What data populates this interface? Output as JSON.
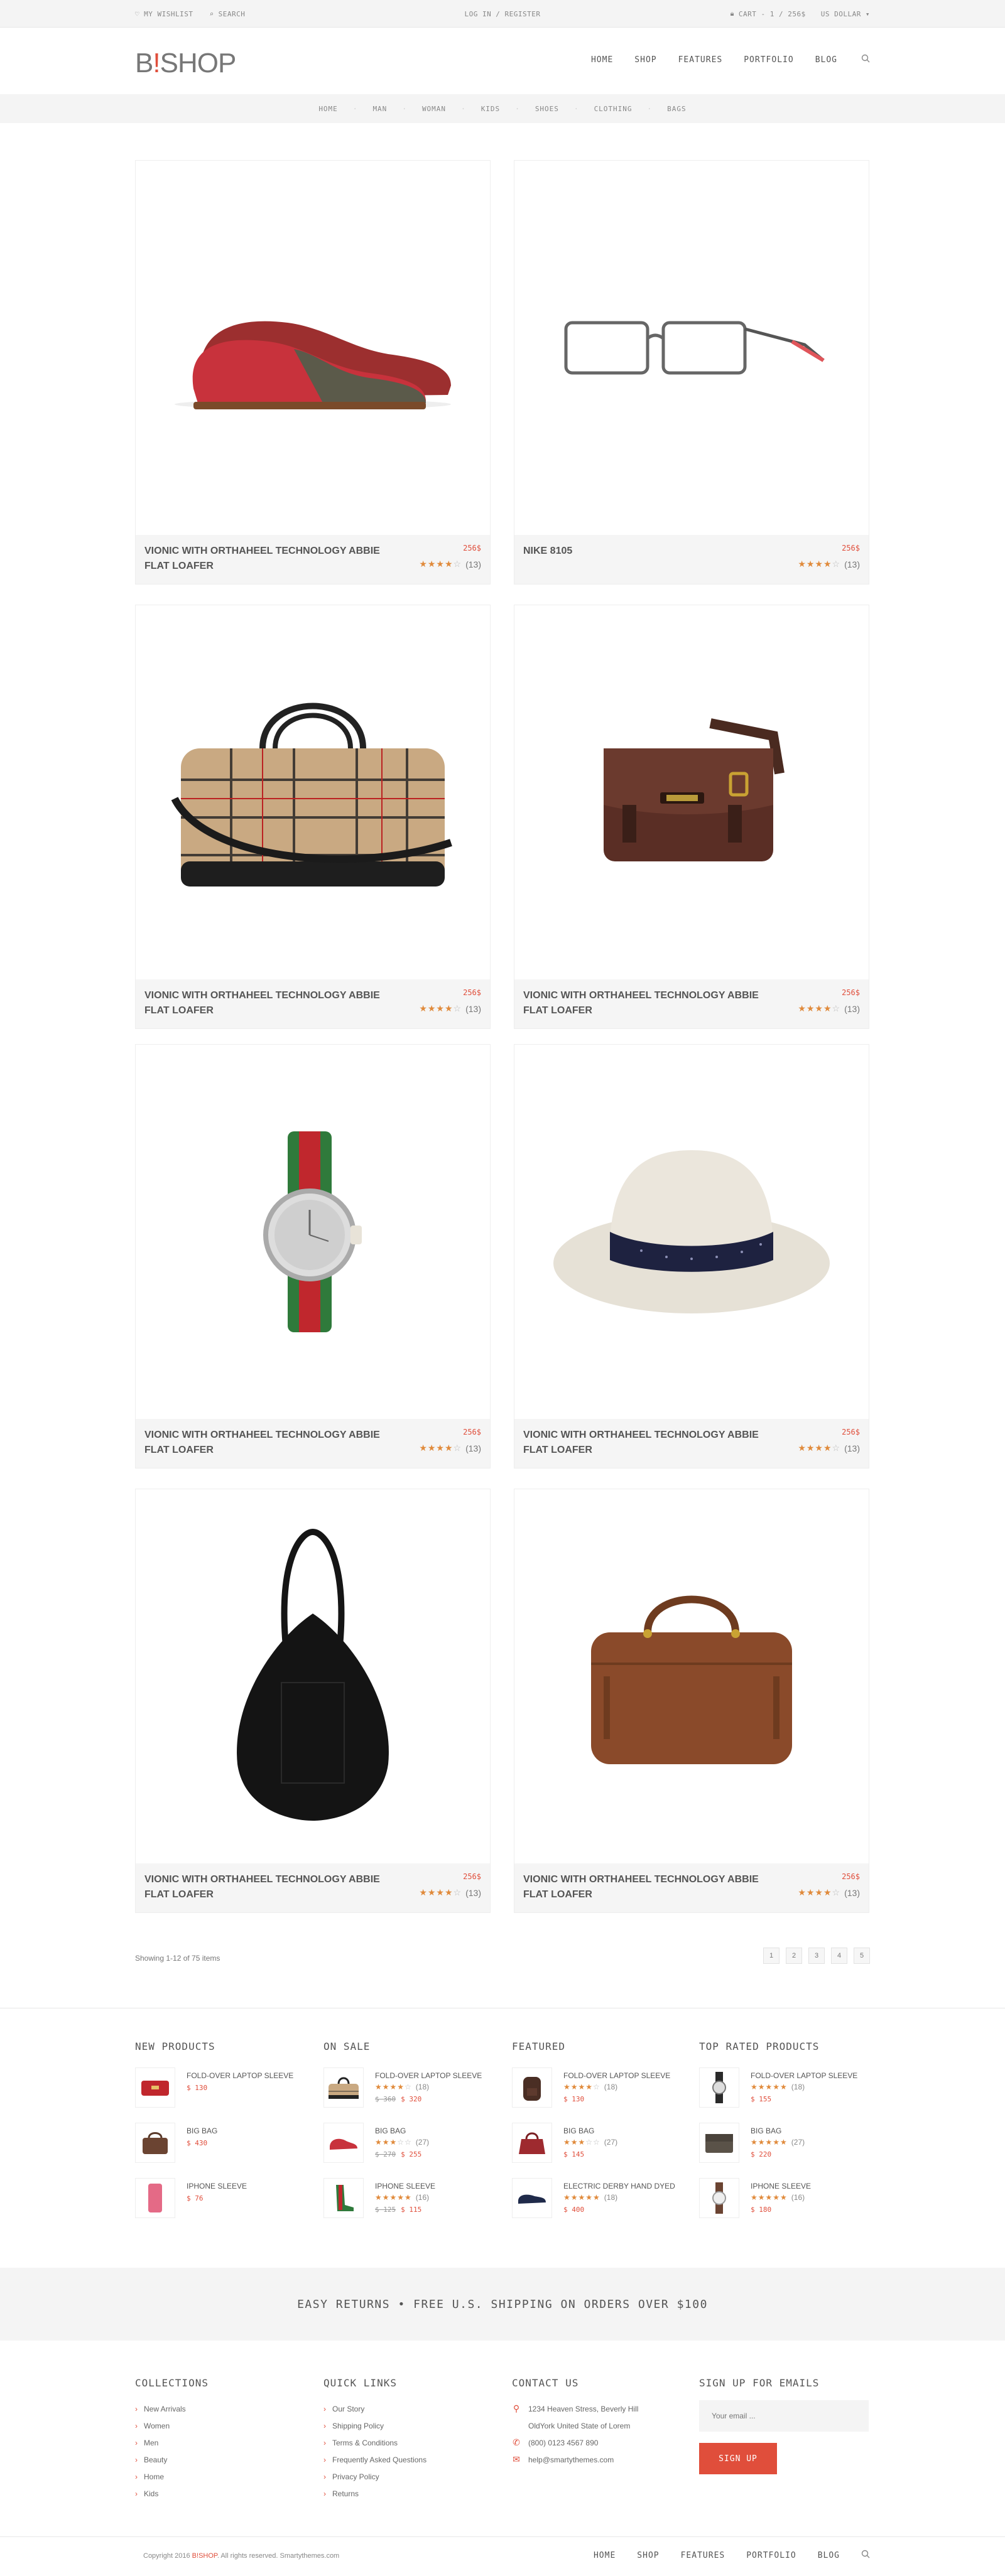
{
  "topbar": {
    "wishlist": "MY WISHLIST",
    "search": "SEARCH",
    "account": "LOG IN / REGISTER",
    "cart": "CART - 1 / 256$",
    "currency": "US DOLLAR"
  },
  "header": {
    "logo_left": "B",
    "logo_mark": "!",
    "logo_right": "SHOP",
    "nav": [
      "HOME",
      "SHOP",
      "FEATURES",
      "PORTFOLIO",
      "BLOG"
    ]
  },
  "categories": [
    "HOME",
    "MAN",
    "WOMAN",
    "KIDS",
    "SHOES",
    "CLOTHING",
    "BAGS"
  ],
  "products": [
    {
      "name": "VIONIC WITH ORTHAHEEL TECHNOLOGY ABBIE FLAT LOAFER",
      "price": "256$",
      "rating": 4,
      "reviews": "(13)",
      "icon": "red-loafers-image"
    },
    {
      "name": "NIKE 8105",
      "price": "256$",
      "rating": 4,
      "reviews": "(13)",
      "icon": "eyeglasses-image"
    },
    {
      "name": "VIONIC WITH ORTHAHEEL TECHNOLOGY ABBIE FLAT LOAFER",
      "price": "256$",
      "rating": 4,
      "reviews": "(13)",
      "icon": "plaid-duffel-bag-image"
    },
    {
      "name": "VIONIC WITH ORTHAHEEL TECHNOLOGY ABBIE FLAT LOAFER",
      "price": "256$",
      "rating": 4,
      "reviews": "(13)",
      "icon": "leather-messenger-bag-image"
    },
    {
      "name": "VIONIC WITH ORTHAHEEL TECHNOLOGY ABBIE FLAT LOAFER",
      "price": "256$",
      "rating": 4,
      "reviews": "(13)",
      "icon": "wristwatch-image"
    },
    {
      "name": "VIONIC WITH ORTHAHEEL TECHNOLOGY ABBIE FLAT LOAFER",
      "price": "256$",
      "rating": 4,
      "reviews": "(13)",
      "icon": "fedora-hat-image"
    },
    {
      "name": "VIONIC WITH ORTHAHEEL TECHNOLOGY ABBIE FLAT LOAFER",
      "price": "256$",
      "rating": 4,
      "reviews": "(13)",
      "icon": "black-hobo-bag-image"
    },
    {
      "name": "VIONIC WITH ORTHAHEEL TECHNOLOGY ABBIE FLAT LOAFER",
      "price": "256$",
      "rating": 4,
      "reviews": "(13)",
      "icon": "brown-duffel-bag-image"
    }
  ],
  "listing": {
    "showing": "Showing 1-12 of 75 items",
    "pages": [
      "1",
      "2",
      "3",
      "4",
      "5"
    ]
  },
  "widgets": [
    {
      "title": "NEW PRODUCTS",
      "items": [
        {
          "name": "FOLD-OVER LAPTOP SLEEVE",
          "price": "$ 130",
          "thumb": "red-clutch"
        },
        {
          "name": "BIG BAG",
          "price": "$ 430",
          "thumb": "brown-satchel"
        },
        {
          "name": "IPHONE SLEEVE",
          "price": "$ 76",
          "thumb": "pink-phone"
        }
      ]
    },
    {
      "title": "ON SALE",
      "items": [
        {
          "name": "FOLD-OVER LAPTOP SLEEVE",
          "rating": 4,
          "reviews": "(18)",
          "old": "$ 360",
          "price": "$ 320",
          "thumb": "plaid-bag"
        },
        {
          "name": "BIG BAG",
          "rating": 3,
          "reviews": "(27)",
          "old": "$ 270",
          "price": "$ 255",
          "thumb": "red-shoe"
        },
        {
          "name": "IPHONE SLEEVE",
          "rating": 5,
          "reviews": "(16)",
          "old": "$ 125",
          "price": "$ 115",
          "thumb": "striped-heel"
        }
      ]
    },
    {
      "title": "FEATURED",
      "items": [
        {
          "name": "FOLD-OVER LAPTOP SLEEVE",
          "rating": 4,
          "reviews": "(18)",
          "price": "$ 130",
          "thumb": "backpack"
        },
        {
          "name": "BIG BAG",
          "rating": 3,
          "reviews": "(27)",
          "price": "$ 145",
          "thumb": "red-handbag"
        },
        {
          "name": "ELECTRIC DERBY HAND DYED",
          "rating": 5,
          "reviews": "(18)",
          "price": "$ 400",
          "thumb": "derby-shoe"
        }
      ]
    },
    {
      "title": "TOP RATED PRODUCTS",
      "items": [
        {
          "name": "FOLD-OVER LAPTOP SLEEVE",
          "rating": 5,
          "reviews": "(18)",
          "price": "$ 155",
          "thumb": "watch"
        },
        {
          "name": "BIG BAG",
          "rating": 5,
          "reviews": "(27)",
          "price": "$ 220",
          "thumb": "grey-bag"
        },
        {
          "name": "IPHONE SLEEVE",
          "rating": 5,
          "reviews": "(16)",
          "price": "$ 180",
          "thumb": "watch-2"
        }
      ]
    }
  ],
  "banner": "EASY RETURNS • FREE U.S. SHIPPING ON ORDERS OVER $100",
  "footer": {
    "collections_title": "COLLECTIONS",
    "collections": [
      "New Arrivals",
      "Women",
      "Men",
      "Beauty",
      "Home",
      "Kids"
    ],
    "quicklinks_title": "QUICK LINKS",
    "quicklinks": [
      "Our Story",
      "Shipping Policy",
      "Terms & Conditions",
      "Frequently Asked Questions",
      "Privacy Policy",
      "Returns"
    ],
    "contact_title": "CONTACT US",
    "contact": [
      {
        "icon": "map-pin-icon",
        "text": "1234 Heaven Stress, Beverly Hill"
      },
      {
        "icon": "",
        "text": "OldYork United State of Lorem"
      },
      {
        "icon": "phone-icon",
        "text": "(800) 0123 4567 890"
      },
      {
        "icon": "mail-icon",
        "text": "help@smartythemes.com"
      }
    ],
    "signup_title": "SIGN UP FOR EMAILS",
    "email_placeholder": "Your email ...",
    "signup_button": "SIGN UP",
    "copyright_prefix": "Copyright 2016 ",
    "copyright_brand": "B!SHOP",
    "copyright_suffix": ". All rights reserved. Smartythemes.com",
    "nav": [
      "HOME",
      "SHOP",
      "FEATURES",
      "PORTFOLIO",
      "BLOG"
    ]
  },
  "colors": {
    "accent": "#e04e3b",
    "star": "#e08a3b",
    "bar": "#f4f4f4"
  }
}
